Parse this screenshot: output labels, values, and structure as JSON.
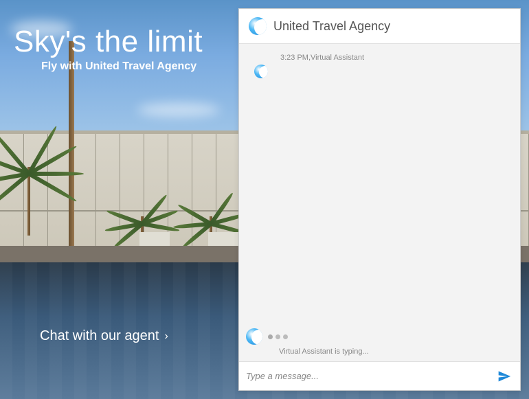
{
  "hero": {
    "title": "Sky's the limit",
    "subtitle": "Fly with United Travel Agency"
  },
  "cta": {
    "label": "Chat with our agent"
  },
  "chat": {
    "header_title": "United Travel Agency",
    "message": {
      "timestamp": "3:23 PM",
      "sender": "Virtual Assistant",
      "meta": "3:23 PM,Virtual Assistant"
    },
    "typing_label": "Virtual Assistant is typing...",
    "input_placeholder": "Type a message..."
  },
  "icons": {
    "logo": "wave-logo-icon",
    "send": "send-icon",
    "chevron_right": "chevron-right-icon"
  },
  "colors": {
    "accent": "#1e88d8"
  }
}
